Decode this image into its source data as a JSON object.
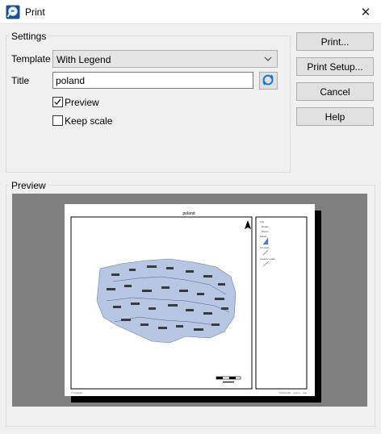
{
  "window": {
    "title": "Print",
    "app_icon": "magnifier-map-icon",
    "close_icon": "close-icon"
  },
  "settings": {
    "group_label": "Settings",
    "template_label": "Template",
    "template_value": "With Legend",
    "title_label": "Title",
    "title_value": "poland",
    "preview": {
      "label": "Preview",
      "checked": true
    },
    "keep_scale": {
      "label": "Keep scale",
      "checked": false
    }
  },
  "buttons": {
    "print": "Print...",
    "print_setup": "Print Setup...",
    "cancel": "Cancel",
    "help": "Help"
  },
  "preview": {
    "group_label": "Preview",
    "page_title": "poland",
    "legend_items": [
      "City",
      "Roads",
      "Rivers",
      "Lakes",
      "Cit. Asst",
      "Country roads"
    ],
    "footer_left": "© Copyright",
    "footer_right": "Printed with ... pica.rp ... map"
  },
  "colors": {
    "accent": "#0a64c8",
    "map_fill": "#b7c6e2",
    "preview_bg": "#808080"
  }
}
